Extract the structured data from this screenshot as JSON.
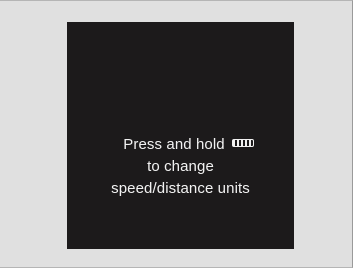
{
  "display": {
    "message_line1": "Press and hold",
    "message_line2": "to change",
    "message_line3": "speed/distance units",
    "button_icon": "steering-button-icon",
    "colors": {
      "background": "#e0e0e0",
      "screen": "#1c1a1b",
      "text": "#f2f2f2"
    }
  }
}
